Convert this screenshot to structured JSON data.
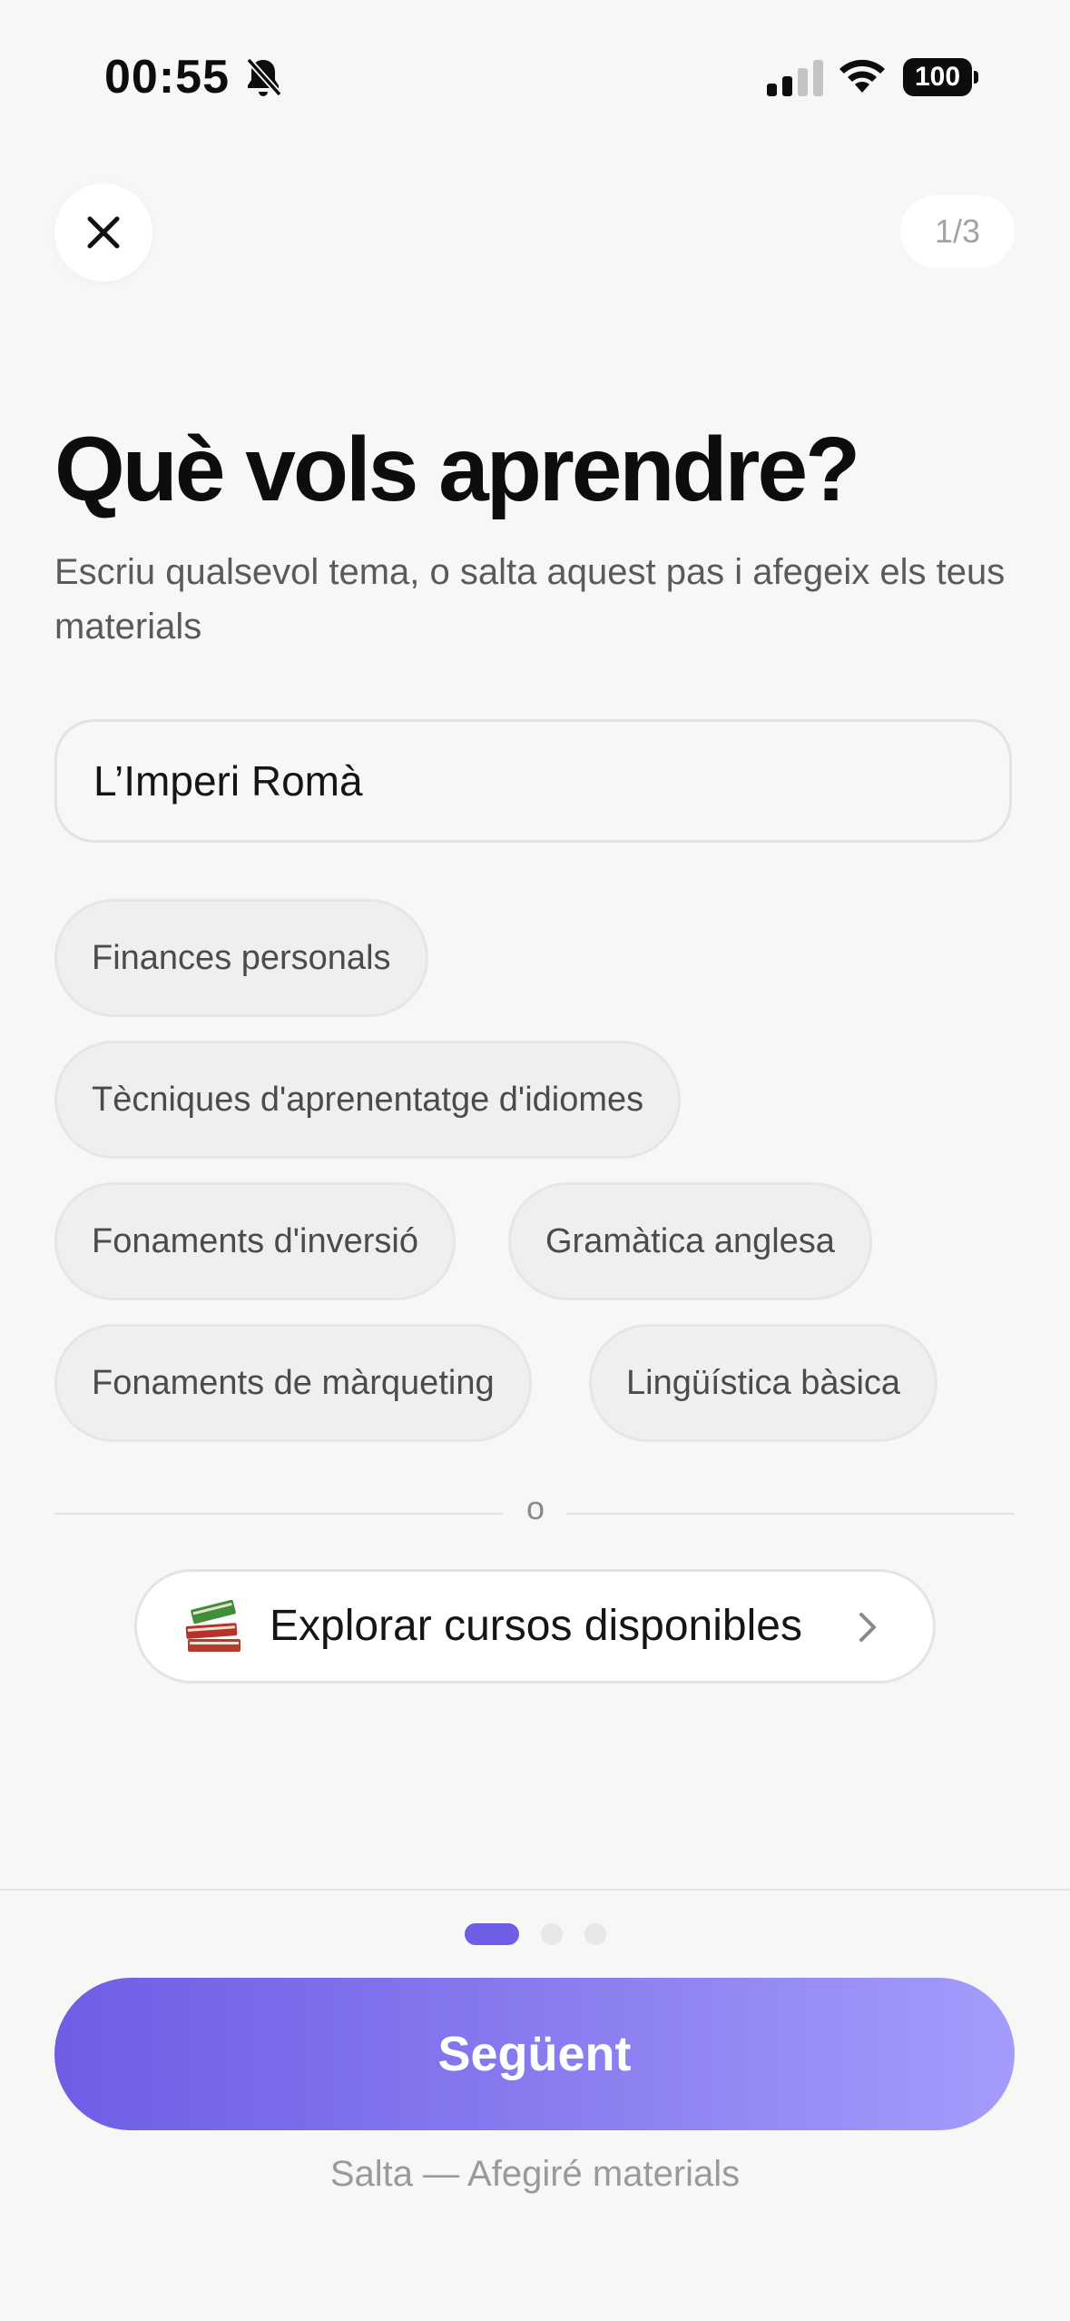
{
  "status_bar": {
    "time": "00:55",
    "battery": "100",
    "icons": [
      "bell-slash-icon",
      "cellular-signal-icon",
      "wifi-icon",
      "battery-icon"
    ]
  },
  "header": {
    "close_icon": "close-icon",
    "step_counter": "1/3"
  },
  "main": {
    "title": "Què vols aprendre?",
    "subtitle": "Escriu qualsevol tema, o salta aquest pas i afegeix els teus materials",
    "input_value": "L’Imperi Romà",
    "suggestions": [
      "Finances personals",
      "Tècniques d'aprenentatge d'idiomes",
      "Fonaments d'inversió",
      "Gramàtica anglesa",
      "Fonaments de màrqueting",
      "Lingüística bàsica"
    ],
    "divider_text": "o",
    "explore": {
      "icon": "books-icon",
      "label": "Explorar cursos disponibles"
    }
  },
  "footer": {
    "page_dots": {
      "count": 3,
      "active": 0
    },
    "next_label": "Següent",
    "skip_label": "Salta — Afegiré materials"
  },
  "colors": {
    "accent": "#6e5ee5",
    "accent_light": "#a49cfc",
    "background": "#f7f7f5",
    "chip_background": "#efefed"
  }
}
